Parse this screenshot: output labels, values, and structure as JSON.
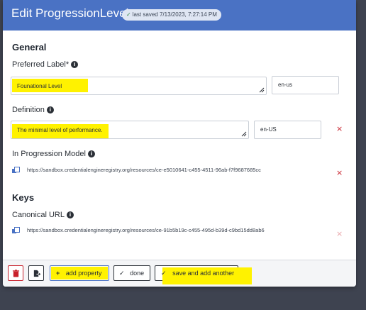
{
  "header": {
    "title": "Edit ProgressionLevel",
    "saved_text": "last saved 7/13/2023, 7:27:14 PM"
  },
  "general": {
    "section_title": "General",
    "preferred_label": {
      "label": "Preferred Label*",
      "value": "Founational Level",
      "language": "en-us"
    },
    "definition": {
      "label": "Definition",
      "value": "The minimal level of performance.",
      "language": "en-US",
      "remove": "×"
    },
    "in_progression_model": {
      "label": "In Progression Model",
      "url": "https://sandbox.credentialengineregistry.org/resources/ce-e5010641-c455-4511-96ab-f7f9687685cc",
      "remove": "×"
    }
  },
  "keys": {
    "section_title": "Keys",
    "canonical_url": {
      "label": "Canonical URL",
      "url": "https://sandbox.credentialengineregistry.org/resources/ce-91b5b19c-c455-495d-b39d-c9bd15dd8ab6",
      "remove": "×"
    }
  },
  "footer": {
    "add_property": "add property",
    "done": "done",
    "save_and_add_another": "save and add another"
  },
  "colors": {
    "header": "#4a72c4",
    "highlight": "#fff200",
    "delete": "#c8202b",
    "background": "#3e4350"
  },
  "icons": [
    "check-icon",
    "info-icon",
    "resize-handle-icon",
    "remove-icon",
    "link-icon",
    "trash-icon",
    "export-icon",
    "plus-icon"
  ]
}
